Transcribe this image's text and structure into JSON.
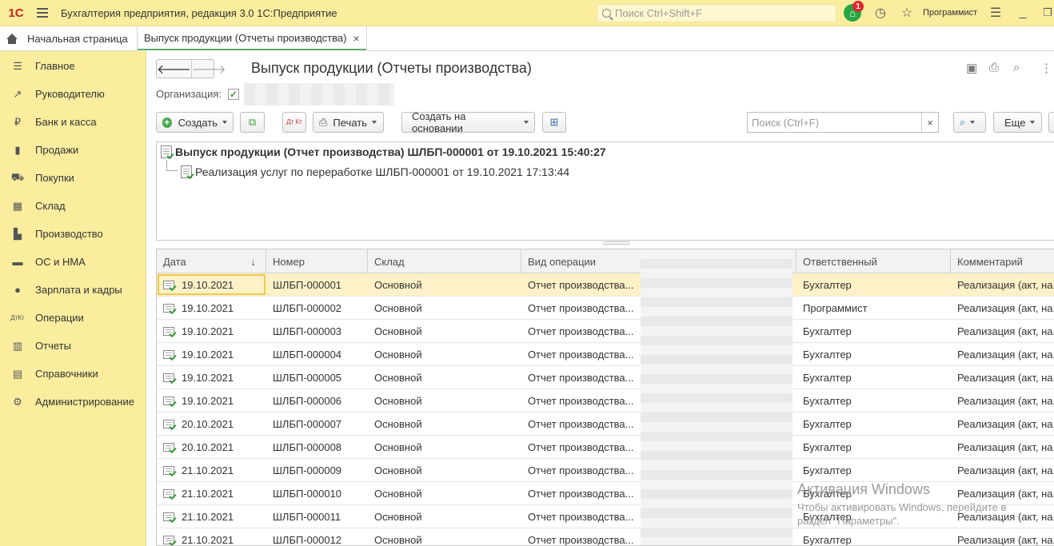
{
  "app": {
    "logo": "1С",
    "title": "Бухгалтерия предприятия, редакция 3.0 1С:Предприятие",
    "search_placeholder": "Поиск Ctrl+Shift+F",
    "notification_count": "1",
    "user": "Программист"
  },
  "tabs": [
    {
      "label": "Начальная страница"
    },
    {
      "label": "Выпуск продукции (Отчеты производства)"
    }
  ],
  "sidebar": {
    "items": [
      {
        "label": "Главное",
        "icon": "menu-lines-icon"
      },
      {
        "label": "Руководителю",
        "icon": "trend-icon"
      },
      {
        "label": "Банк и касса",
        "icon": "coin-icon"
      },
      {
        "label": "Продажи",
        "icon": "bag-icon"
      },
      {
        "label": "Покупки",
        "icon": "cart-icon"
      },
      {
        "label": "Склад",
        "icon": "grid-icon"
      },
      {
        "label": "Производство",
        "icon": "factory-icon"
      },
      {
        "label": "ОС и НМА",
        "icon": "truck-icon"
      },
      {
        "label": "Зарплата и кадры",
        "icon": "person-icon"
      },
      {
        "label": "Операции",
        "icon": "dt-kt-icon"
      },
      {
        "label": "Отчеты",
        "icon": "bar-chart-icon"
      },
      {
        "label": "Справочники",
        "icon": "books-icon"
      },
      {
        "label": "Администрирование",
        "icon": "gear-icon"
      }
    ]
  },
  "form": {
    "title": "Выпуск продукции (Отчеты производства)",
    "org_label": "Организация:",
    "toolbar": {
      "create": "Создать",
      "dtkt": "Дт Кт",
      "print": "Печать",
      "create_based": "Создать на основании",
      "search_placeholder": "Поиск (Ctrl+F)",
      "clear": "×",
      "more": "Еще"
    },
    "tree": {
      "parent": "Выпуск продукции (Отчет производства) ШЛБП-000001 от 19.10.2021 15:40:27",
      "child": "Реализация услуг по переработке ШЛБП-000001 от 19.10.2021 17:13:44"
    }
  },
  "table": {
    "columns": [
      "Дата",
      "Номер",
      "Склад",
      "Вид операции",
      "Ответственный",
      "Комментарий"
    ],
    "sort_indicator": "↓",
    "rows": [
      {
        "date": "19.10.2021",
        "number": "ШЛБП-000001",
        "warehouse": "Основной",
        "operation": "Отчет производства...",
        "responsible": "Бухгалтер",
        "comment": "Реализация (акт, на..."
      },
      {
        "date": "19.10.2021",
        "number": "ШЛБП-000002",
        "warehouse": "Основной",
        "operation": "Отчет производства...",
        "responsible": "Программист",
        "comment": "Реализация (акт, на..."
      },
      {
        "date": "19.10.2021",
        "number": "ШЛБП-000003",
        "warehouse": "Основной",
        "operation": "Отчет производства...",
        "responsible": "Бухгалтер",
        "comment": "Реализация (акт, на..."
      },
      {
        "date": "19.10.2021",
        "number": "ШЛБП-000004",
        "warehouse": "Основной",
        "operation": "Отчет производства...",
        "responsible": "Бухгалтер",
        "comment": "Реализация (акт, на..."
      },
      {
        "date": "19.10.2021",
        "number": "ШЛБП-000005",
        "warehouse": "Основной",
        "operation": "Отчет производства...",
        "responsible": "Бухгалтер",
        "comment": "Реализация (акт, на..."
      },
      {
        "date": "19.10.2021",
        "number": "ШЛБП-000006",
        "warehouse": "Основной",
        "operation": "Отчет производства...",
        "responsible": "Бухгалтер",
        "comment": "Реализация (акт, на..."
      },
      {
        "date": "20.10.2021",
        "number": "ШЛБП-000007",
        "warehouse": "Основной",
        "operation": "Отчет производства...",
        "responsible": "Бухгалтер",
        "comment": "Реализация (акт, на..."
      },
      {
        "date": "20.10.2021",
        "number": "ШЛБП-000008",
        "warehouse": "Основной",
        "operation": "Отчет производства...",
        "responsible": "Бухгалтер",
        "comment": "Реализация (акт, на..."
      },
      {
        "date": "21.10.2021",
        "number": "ШЛБП-000009",
        "warehouse": "Основной",
        "operation": "Отчет производства...",
        "responsible": "Бухгалтер",
        "comment": "Реализация (акт, на..."
      },
      {
        "date": "21.10.2021",
        "number": "ШЛБП-000010",
        "warehouse": "Основной",
        "operation": "Отчет производства...",
        "responsible": "Бухгалтер",
        "comment": "Реализация (акт, на..."
      },
      {
        "date": "21.10.2021",
        "number": "ШЛБП-000011",
        "warehouse": "Основной",
        "operation": "Отчет производства...",
        "responsible": "Бухгалтер",
        "comment": "Реализация (акт, на..."
      },
      {
        "date": "21.10.2021",
        "number": "ШЛБП-000012",
        "warehouse": "Основной",
        "operation": "Отчет производства...",
        "responsible": "Бухгалтер",
        "comment": "Реализация (акт, на..."
      }
    ]
  },
  "watermark": {
    "line1": "Активация Windows",
    "line2": "Чтобы активировать Windows, перейдите в",
    "line3": "раздел \"Параметры\"."
  },
  "colors": {
    "sidebar_bg": "#fbed9e",
    "selected_row": "#fdf1c7",
    "accent_green": "#4aa84f",
    "brand_red": "#d0231b"
  }
}
